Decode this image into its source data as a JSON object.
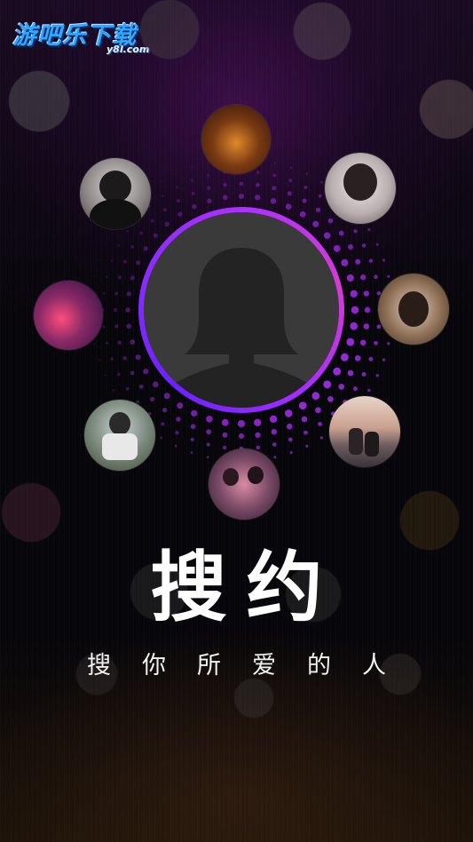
{
  "watermark": {
    "name": "游吧乐下载",
    "domain": "y8l.com"
  },
  "hero": {
    "title": "搜约",
    "tagline": "搜你所爱的人"
  },
  "colors": {
    "ring_start": "#6b22ff",
    "ring_end": "#d43bd6",
    "dots": "#b030ff",
    "background": "#07060a",
    "text": "#ffffff"
  },
  "profiles": [
    {
      "label": "profile-photo-1"
    },
    {
      "label": "profile-photo-2"
    },
    {
      "label": "profile-photo-3"
    },
    {
      "label": "profile-photo-4"
    },
    {
      "label": "profile-photo-5"
    },
    {
      "label": "profile-photo-6"
    },
    {
      "label": "profile-photo-7"
    },
    {
      "label": "profile-photo-8"
    },
    {
      "label": "profile-photo-9"
    }
  ]
}
